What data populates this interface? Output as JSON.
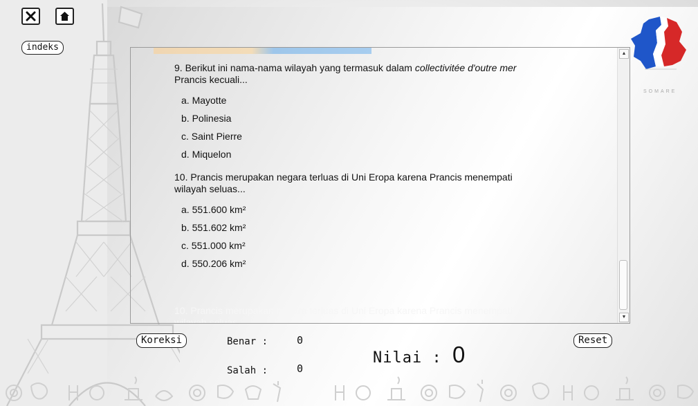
{
  "header": {
    "close_icon": "close-icon",
    "home_icon": "home-icon",
    "indeks_label": "indeks"
  },
  "brand": {
    "text": "SOMARE",
    "colors": {
      "red": "#d62828",
      "blue": "#1f56c9"
    }
  },
  "questions": [
    {
      "number": "9.",
      "text_before": "Berikut ini nama-nama wilayah yang termasuk dalam ",
      "text_italic": "collectivitée d'outre mer",
      "text_after": " Prancis kecuali...",
      "options": [
        "a. Mayotte",
        "b. Polinesia",
        "c. Saint Pierre",
        "d. Miquelon"
      ]
    },
    {
      "number": "10.",
      "text": "Prancis merupakan negara terluas di Uni Eropa karena Prancis menempati wilayah seluas...",
      "options": [
        "a. 551.600 km²",
        "b. 551.602 km²",
        "c. 551.000 km²",
        "d. 550.206 km²"
      ]
    }
  ],
  "ghost_text": "10. Prancis merupakan negara terluas di Uni Eropa karena Prancis menempati wilayah seluas...",
  "score": {
    "koreksi_label": "Koreksi",
    "reset_label": "Reset",
    "benar_label": "Benar :",
    "benar_value": "0",
    "salah_label": "Salah :",
    "salah_value": "0",
    "nilai_label": "Nilai :",
    "nilai_value": "0"
  }
}
